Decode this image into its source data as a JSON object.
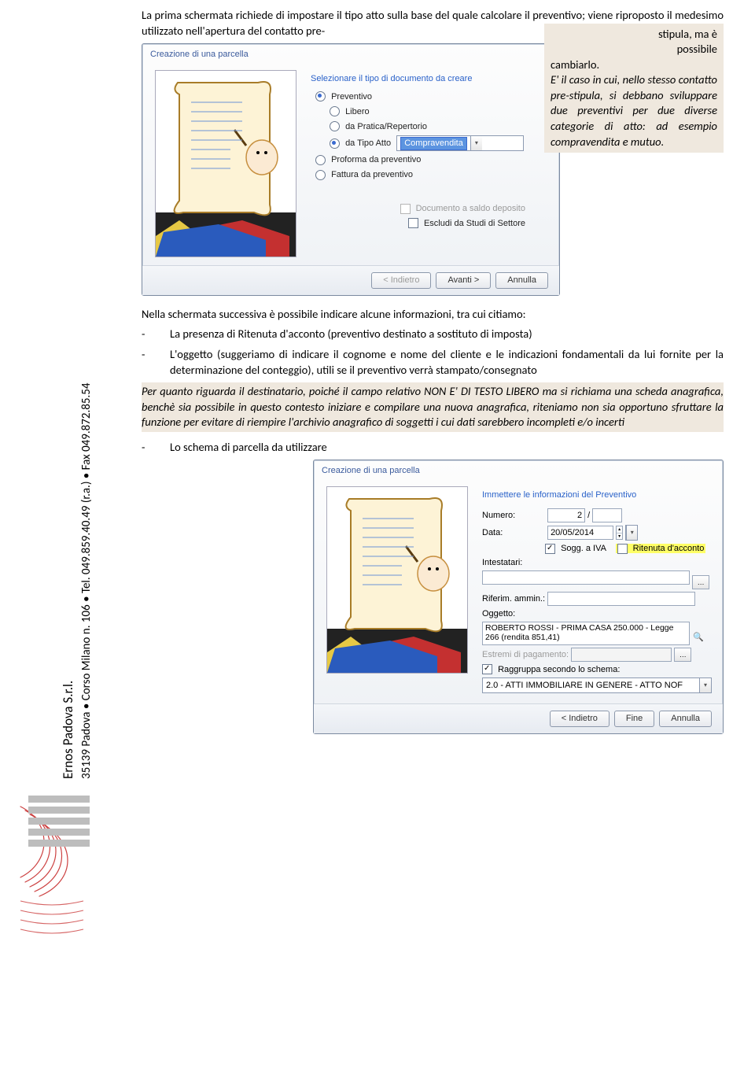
{
  "rail": {
    "company": "Ernos Padova S.r.l.",
    "address": "35139 Padova • Corso Milano n. 106 • Tel. 049.859.40.49  (r.a.) • Fax 049.872.85.54"
  },
  "intro_paragraph": "La prima schermata richiede di impostare il tipo atto sulla base del quale calcolare il preventivo; viene riproposto il medesimo utilizzato nell'apertura del contatto pre-stipula, ma è possibile cambiarlo.",
  "note_right": "E' il caso in cui, nello stesso contatto pre-stipula, si debbano sviluppare due preventivi per due diverse categorie di atto: ad esempio compravendita e mutuo.",
  "dlg1": {
    "title": "Creazione di una parcella",
    "section": "Selezionare il tipo di documento da creare",
    "r_preventivo": "Preventivo",
    "r_libero": "Libero",
    "r_pratica": "da Pratica/Repertorio",
    "r_tipoatto": "da Tipo Atto",
    "tipoatto_value": "Compravendita",
    "r_proforma": "Proforma da preventivo",
    "r_fattura": "Fattura da preventivo",
    "chk_saldo": "Documento a saldo deposito",
    "chk_escludi": "Escludi da Studi di Settore",
    "btn_back": "< Indietro",
    "btn_next": "Avanti >",
    "btn_cancel": "Annulla"
  },
  "mid_para": "Nella schermata successiva è possibile indicare alcune informazioni, tra cui citiamo:",
  "bullet1": "La presenza di Ritenuta d'acconto (preventivo destinato a sostituto di imposta)",
  "bullet2": "L'oggetto (suggeriamo di indicare il cognome e nome del cliente e le indicazioni fondamentali da lui fornite per la determinazione del conteggio), utili se il preventivo verrà stampato/consegnato",
  "note_mid": "Per quanto riguarda il destinatario, poiché il campo relativo NON E' DI TESTO LIBERO ma si richiama una scheda anagrafica, benchè sia possibile in questo contesto iniziare e compilare una nuova anagrafica, riteniamo non sia opportuno sfruttare la funzione per evitare di riempire l'archivio anagrafico di soggetti i cui dati sarebbero incompleti e/o incerti",
  "bullet3": "Lo schema di parcella da utilizzare",
  "dlg2": {
    "title": "Creazione di una parcella",
    "section": "Immettere le informazioni del Preventivo",
    "lbl_numero": "Numero:",
    "val_numero": "2",
    "lbl_data": "Data:",
    "val_data": "20/05/2014",
    "chk_sogg": "Sogg. a IVA",
    "chk_rit": "Ritenuta d'acconto",
    "lbl_intest": "Intestatari:",
    "lbl_riferim": "Riferim. ammin.:",
    "lbl_oggetto": "Oggetto:",
    "val_oggetto": "ROBERTO ROSSI - PRIMA CASA 250.000 - Legge 266 (rendita 851,41)",
    "lbl_estremi": "Estremi di pagamento:",
    "chk_ragg": "Raggruppa secondo lo schema:",
    "val_schema": "2.0 - ATTI IMMOBILIARE IN GENERE - ATTO NOF",
    "btn_back": "< Indietro",
    "btn_finish": "Fine",
    "btn_cancel": "Annulla"
  }
}
